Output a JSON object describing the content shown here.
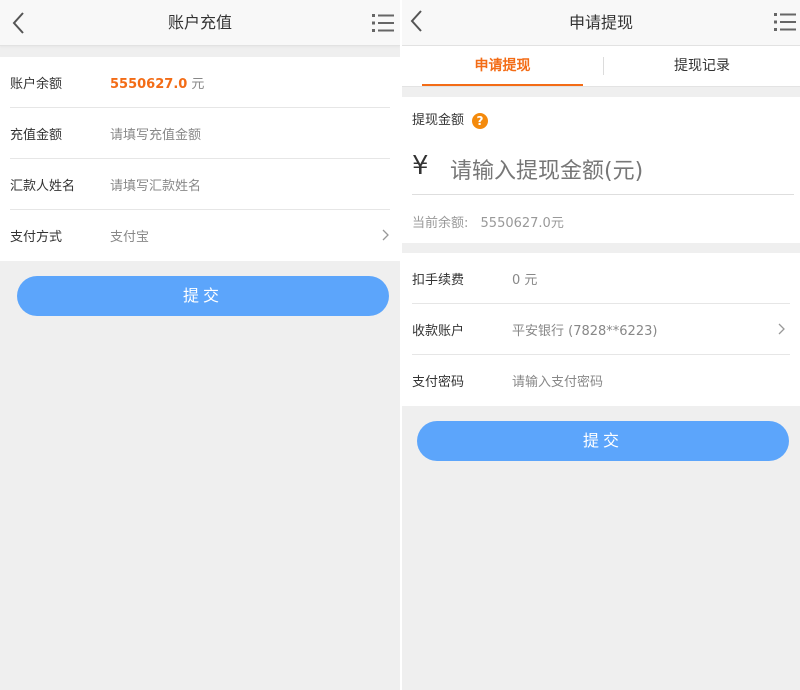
{
  "recharge": {
    "title": "账户充值",
    "rows": [
      {
        "label": "账户余额",
        "value": "5550627.0",
        "unit": "元"
      },
      {
        "label": "充值金额",
        "placeholder": "请填写充值金额"
      },
      {
        "label": "汇款人姓名",
        "placeholder": "请填写汇款姓名"
      },
      {
        "label": "支付方式",
        "value": "支付宝"
      }
    ],
    "submit_label": "提交"
  },
  "withdraw": {
    "title": "申请提现",
    "tabs": [
      {
        "label": "申请提现",
        "active": true
      },
      {
        "label": "提现记录",
        "active": false
      }
    ],
    "amount_label": "提现金额",
    "currency_symbol": "¥",
    "amount_placeholder": "请输入提现金额(元)",
    "balance_label": "当前余额:",
    "balance_value": "5550627.0元",
    "rows": [
      {
        "label": "扣手续费",
        "value": "0 元"
      },
      {
        "label": "收款账户",
        "value": "平安银行 (7828**6223)"
      },
      {
        "label": "支付密码",
        "placeholder": "请输入支付密码"
      }
    ],
    "submit_label": "提交"
  },
  "colors": {
    "accent": "#f36c16",
    "button": "#5ca5fb",
    "help_icon": "#f48a0c"
  }
}
